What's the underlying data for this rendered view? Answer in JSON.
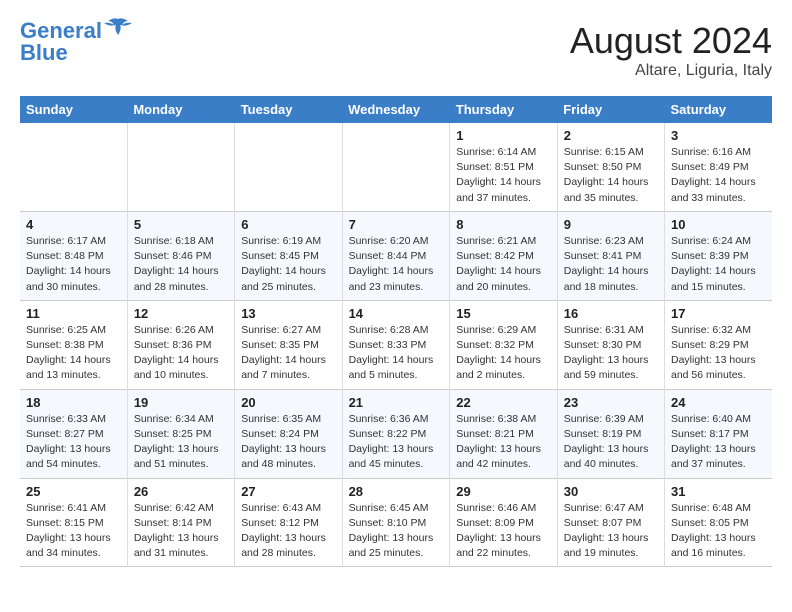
{
  "header": {
    "logo_line1": "General",
    "logo_line2": "Blue",
    "month": "August 2024",
    "location": "Altare, Liguria, Italy"
  },
  "weekdays": [
    "Sunday",
    "Monday",
    "Tuesday",
    "Wednesday",
    "Thursday",
    "Friday",
    "Saturday"
  ],
  "weeks": [
    [
      {
        "day": "",
        "info": ""
      },
      {
        "day": "",
        "info": ""
      },
      {
        "day": "",
        "info": ""
      },
      {
        "day": "",
        "info": ""
      },
      {
        "day": "1",
        "info": "Sunrise: 6:14 AM\nSunset: 8:51 PM\nDaylight: 14 hours and 37 minutes."
      },
      {
        "day": "2",
        "info": "Sunrise: 6:15 AM\nSunset: 8:50 PM\nDaylight: 14 hours and 35 minutes."
      },
      {
        "day": "3",
        "info": "Sunrise: 6:16 AM\nSunset: 8:49 PM\nDaylight: 14 hours and 33 minutes."
      }
    ],
    [
      {
        "day": "4",
        "info": "Sunrise: 6:17 AM\nSunset: 8:48 PM\nDaylight: 14 hours and 30 minutes."
      },
      {
        "day": "5",
        "info": "Sunrise: 6:18 AM\nSunset: 8:46 PM\nDaylight: 14 hours and 28 minutes."
      },
      {
        "day": "6",
        "info": "Sunrise: 6:19 AM\nSunset: 8:45 PM\nDaylight: 14 hours and 25 minutes."
      },
      {
        "day": "7",
        "info": "Sunrise: 6:20 AM\nSunset: 8:44 PM\nDaylight: 14 hours and 23 minutes."
      },
      {
        "day": "8",
        "info": "Sunrise: 6:21 AM\nSunset: 8:42 PM\nDaylight: 14 hours and 20 minutes."
      },
      {
        "day": "9",
        "info": "Sunrise: 6:23 AM\nSunset: 8:41 PM\nDaylight: 14 hours and 18 minutes."
      },
      {
        "day": "10",
        "info": "Sunrise: 6:24 AM\nSunset: 8:39 PM\nDaylight: 14 hours and 15 minutes."
      }
    ],
    [
      {
        "day": "11",
        "info": "Sunrise: 6:25 AM\nSunset: 8:38 PM\nDaylight: 14 hours and 13 minutes."
      },
      {
        "day": "12",
        "info": "Sunrise: 6:26 AM\nSunset: 8:36 PM\nDaylight: 14 hours and 10 minutes."
      },
      {
        "day": "13",
        "info": "Sunrise: 6:27 AM\nSunset: 8:35 PM\nDaylight: 14 hours and 7 minutes."
      },
      {
        "day": "14",
        "info": "Sunrise: 6:28 AM\nSunset: 8:33 PM\nDaylight: 14 hours and 5 minutes."
      },
      {
        "day": "15",
        "info": "Sunrise: 6:29 AM\nSunset: 8:32 PM\nDaylight: 14 hours and 2 minutes."
      },
      {
        "day": "16",
        "info": "Sunrise: 6:31 AM\nSunset: 8:30 PM\nDaylight: 13 hours and 59 minutes."
      },
      {
        "day": "17",
        "info": "Sunrise: 6:32 AM\nSunset: 8:29 PM\nDaylight: 13 hours and 56 minutes."
      }
    ],
    [
      {
        "day": "18",
        "info": "Sunrise: 6:33 AM\nSunset: 8:27 PM\nDaylight: 13 hours and 54 minutes."
      },
      {
        "day": "19",
        "info": "Sunrise: 6:34 AM\nSunset: 8:25 PM\nDaylight: 13 hours and 51 minutes."
      },
      {
        "day": "20",
        "info": "Sunrise: 6:35 AM\nSunset: 8:24 PM\nDaylight: 13 hours and 48 minutes."
      },
      {
        "day": "21",
        "info": "Sunrise: 6:36 AM\nSunset: 8:22 PM\nDaylight: 13 hours and 45 minutes."
      },
      {
        "day": "22",
        "info": "Sunrise: 6:38 AM\nSunset: 8:21 PM\nDaylight: 13 hours and 42 minutes."
      },
      {
        "day": "23",
        "info": "Sunrise: 6:39 AM\nSunset: 8:19 PM\nDaylight: 13 hours and 40 minutes."
      },
      {
        "day": "24",
        "info": "Sunrise: 6:40 AM\nSunset: 8:17 PM\nDaylight: 13 hours and 37 minutes."
      }
    ],
    [
      {
        "day": "25",
        "info": "Sunrise: 6:41 AM\nSunset: 8:15 PM\nDaylight: 13 hours and 34 minutes."
      },
      {
        "day": "26",
        "info": "Sunrise: 6:42 AM\nSunset: 8:14 PM\nDaylight: 13 hours and 31 minutes."
      },
      {
        "day": "27",
        "info": "Sunrise: 6:43 AM\nSunset: 8:12 PM\nDaylight: 13 hours and 28 minutes."
      },
      {
        "day": "28",
        "info": "Sunrise: 6:45 AM\nSunset: 8:10 PM\nDaylight: 13 hours and 25 minutes."
      },
      {
        "day": "29",
        "info": "Sunrise: 6:46 AM\nSunset: 8:09 PM\nDaylight: 13 hours and 22 minutes."
      },
      {
        "day": "30",
        "info": "Sunrise: 6:47 AM\nSunset: 8:07 PM\nDaylight: 13 hours and 19 minutes."
      },
      {
        "day": "31",
        "info": "Sunrise: 6:48 AM\nSunset: 8:05 PM\nDaylight: 13 hours and 16 minutes."
      }
    ]
  ]
}
